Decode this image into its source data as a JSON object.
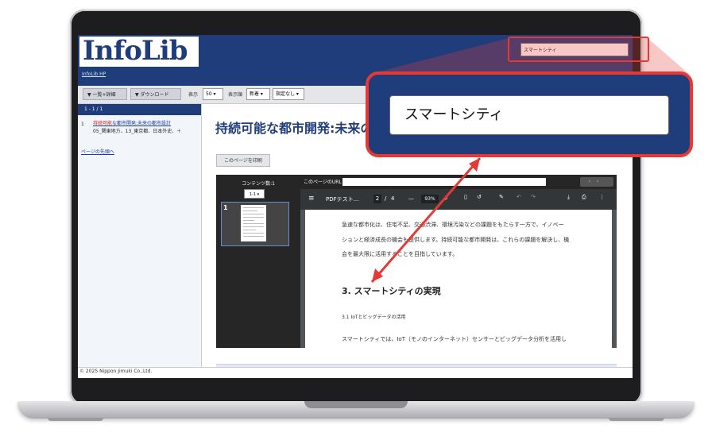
{
  "header": {
    "logo_text": "InfoLib",
    "hp_link": "InfoLib HP",
    "search_value": "スマートシティ"
  },
  "toolbar": {
    "list_detail_button": "▼ 一覧+詳細",
    "download_button": "▼ ダウンロード",
    "display_label": "表示",
    "display_count": "50",
    "order_label": "表示順",
    "order_value": "新着",
    "filter_value": "指定なし"
  },
  "results": {
    "range": "1 - 1 / 1",
    "items": [
      {
        "number": "1",
        "title_highlight": "持続可能",
        "title_rest": "な都市開発:未来の都市設計",
        "meta": "05_関東地方、13_東京都、日本外史、＋"
      }
    ],
    "back_to_top": "ページの先頭へ"
  },
  "document": {
    "title": "持続可能な都市開発:未来の都市設計",
    "print_button": "このページを印刷",
    "content_count_label": "コンテンツ数:1",
    "content_select": "1-1",
    "thumb_number": "1",
    "url_label": "このページのURL"
  },
  "pdf_viewer": {
    "menu_icon": "≡",
    "file_name": "PDFテスト...",
    "page_current": "2",
    "page_separator": "/",
    "page_total": "4",
    "zoom_minus": "—",
    "zoom": "93%",
    "zoom_plus": "+",
    "lines": [
      "急速な都市化は、住宅不足、交通渋滞、環境汚染などの課題をもたらす一方で、イノベー",
      "ションと経済成長の機会も提供します。持続可能な都市開発は、これらの課題を解決し、機",
      "会を最大限に活用することを目指しています。"
    ],
    "section_heading": "3. スマートシティの実現",
    "subsection": "3.1 IoTとビッグデータの活用",
    "body_start": "スマートシティでは、IoT（モノのインターネット）センサーとビッグデータ分析を活用し"
  },
  "footer": {
    "copyright": "© 2025 Nippon Jimuki Co.,Ltd."
  },
  "magnifier": {
    "search_value": "スマートシティ"
  },
  "colors": {
    "brand_navy": "#1f3d7a",
    "highlight_red": "#e53935"
  }
}
